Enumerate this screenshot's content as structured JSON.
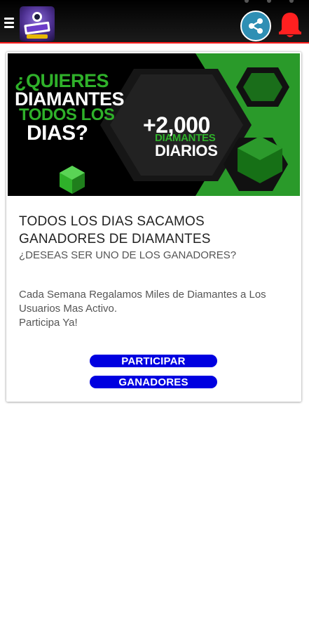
{
  "app_bar": {
    "menu_icon": "hamburger-menu-icon",
    "logo_icon": "app-logo-icon",
    "share_icon": "share-icon",
    "bell_icon": "notification-bell-icon",
    "accent_color": "#ff1e1e"
  },
  "banner": {
    "q_prefix": "¿",
    "q_word": "QUIERES",
    "line2": "DIAMANTES",
    "line3": "TODOS LOS",
    "line4": "DIAS?",
    "amount": "+2,000",
    "amount_unit": "DIAMANTES",
    "amount_suffix": "DIARIOS",
    "green": "#2fb12a"
  },
  "card": {
    "heading": "TODOS LOS DIAS SACAMOS GANADORES DE DIAMANTES",
    "subheading": "¿DESEAS SER UNO DE LOS GANADORES?",
    "body_line1": "Cada Semana Regalamos Miles de Diamantes a Los Usuarios Mas Activo.",
    "body_line2": "Participa Ya!",
    "participar_label": "PARTICIPAR",
    "ganadores_label": "GANADORES",
    "button_color": "#0000e0"
  }
}
